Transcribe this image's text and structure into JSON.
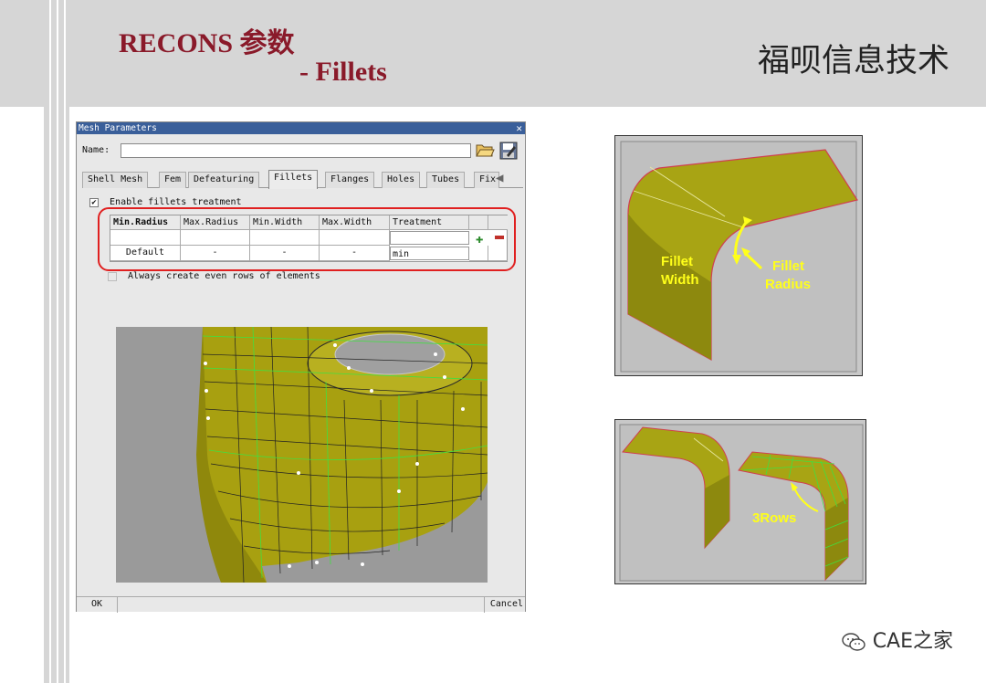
{
  "header": {
    "title": "RECONS 参数",
    "subtitle": "- Fillets",
    "brand": "福呗信息技术"
  },
  "dialog": {
    "title": "Mesh Parameters",
    "close_icon": "close-icon",
    "name_label": "Name:",
    "name_value": "",
    "tabs": [
      "Shell Mesh",
      "Fem",
      "Defeaturing",
      "Fillets",
      "Flanges",
      "Holes",
      "Tubes",
      "Fix"
    ],
    "active_tab": "Fillets",
    "enable_fillets_label": "Enable fillets treatment",
    "enable_fillets_checked": true,
    "table": {
      "headers": [
        "Min.Radius",
        "Max.Radius",
        "Min.Width",
        "Max.Width",
        "Treatment"
      ],
      "rows": [
        [
          "",
          "",
          "",
          "",
          ""
        ],
        [
          "Default",
          "-",
          "-",
          "-",
          "min"
        ]
      ]
    },
    "even_rows_label": "Always create even rows of elements",
    "even_rows_checked": false,
    "ok_label": "OK",
    "cancel_label": "Cancel"
  },
  "illustration_top": {
    "label_width": "Fillet\nWidth",
    "label_width_line1": "Fillet",
    "label_width_line2": "Width",
    "label_radius_line1": "Fillet",
    "label_radius_line2": "Radius"
  },
  "illustration_bottom": {
    "label_rows": "3Rows"
  },
  "watermark": {
    "text": "CAE之家",
    "icon": "wechat-icon"
  },
  "colors": {
    "title_red": "#8a1a2a",
    "header_gray": "#d6d6d6",
    "annotation_yellow": "#ffff1a",
    "highlight_red": "#e02020",
    "surface_olive": "#9e9a10"
  }
}
